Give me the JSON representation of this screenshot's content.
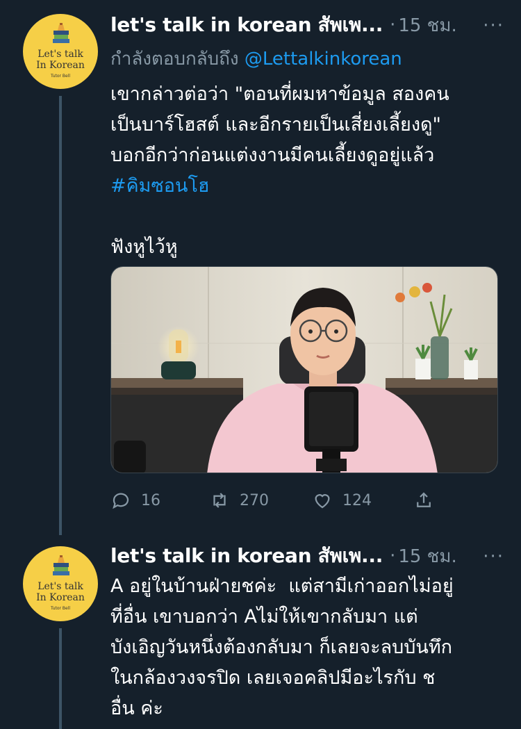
{
  "tweets": [
    {
      "avatar": {
        "line1": "Let's talk",
        "line2": "In Korean",
        "line3": "Tutor Bell"
      },
      "display_name": "let's talk in korean สัพเพ...",
      "separator": "·",
      "time": "15 ชม.",
      "more": "···",
      "reply_prefix": "กำลังตอบกลับถึง",
      "reply_handle": "@Lettalkinkorean",
      "text_line1": "เขากล่าวต่อว่า \"ตอนที่ผมหาข้อมูล สองคน",
      "text_line2": "เป็นบาร์โฮสต์ และอีกรายเป็นเสี่ยงเลี้ยงดู\"",
      "text_line3": "บอกอีกว่าก่อนแต่งงานมีคนเลี้ยงดูอยู่แล้ว",
      "hashtag": "#คิมซอนโฮ",
      "text_after": "ฟังหูไว้หู",
      "stats": {
        "replies": "16",
        "retweets": "270",
        "likes": "124"
      }
    },
    {
      "avatar": {
        "line1": "Let's talk",
        "line2": "In Korean",
        "line3": "Tutor Bell"
      },
      "display_name": "let's talk in korean สัพเพ...",
      "separator": "·",
      "time": "15 ชม.",
      "more": "···",
      "text": "A อยู่ในบ้านฝ่ายชค่ะ  แต่สามีเก่าออกไม่อยู่\nที่อื่น เขาบอกว่า Aไม่ให้เขากลับมา แต่\nบังเอิญวันหนึ่งต้องกลับมา ก็เลยจะลบบันทึก\nในกล้องวงจรปิด เลยเจอคลิปมีอะไรกับ ช\nอื่น ค่ะ"
    }
  ],
  "colors": {
    "background": "#15202b",
    "text": "#ffffff",
    "secondary": "#8899a6",
    "link": "#1d9bf0",
    "avatar_bg": "#f6cf47"
  }
}
